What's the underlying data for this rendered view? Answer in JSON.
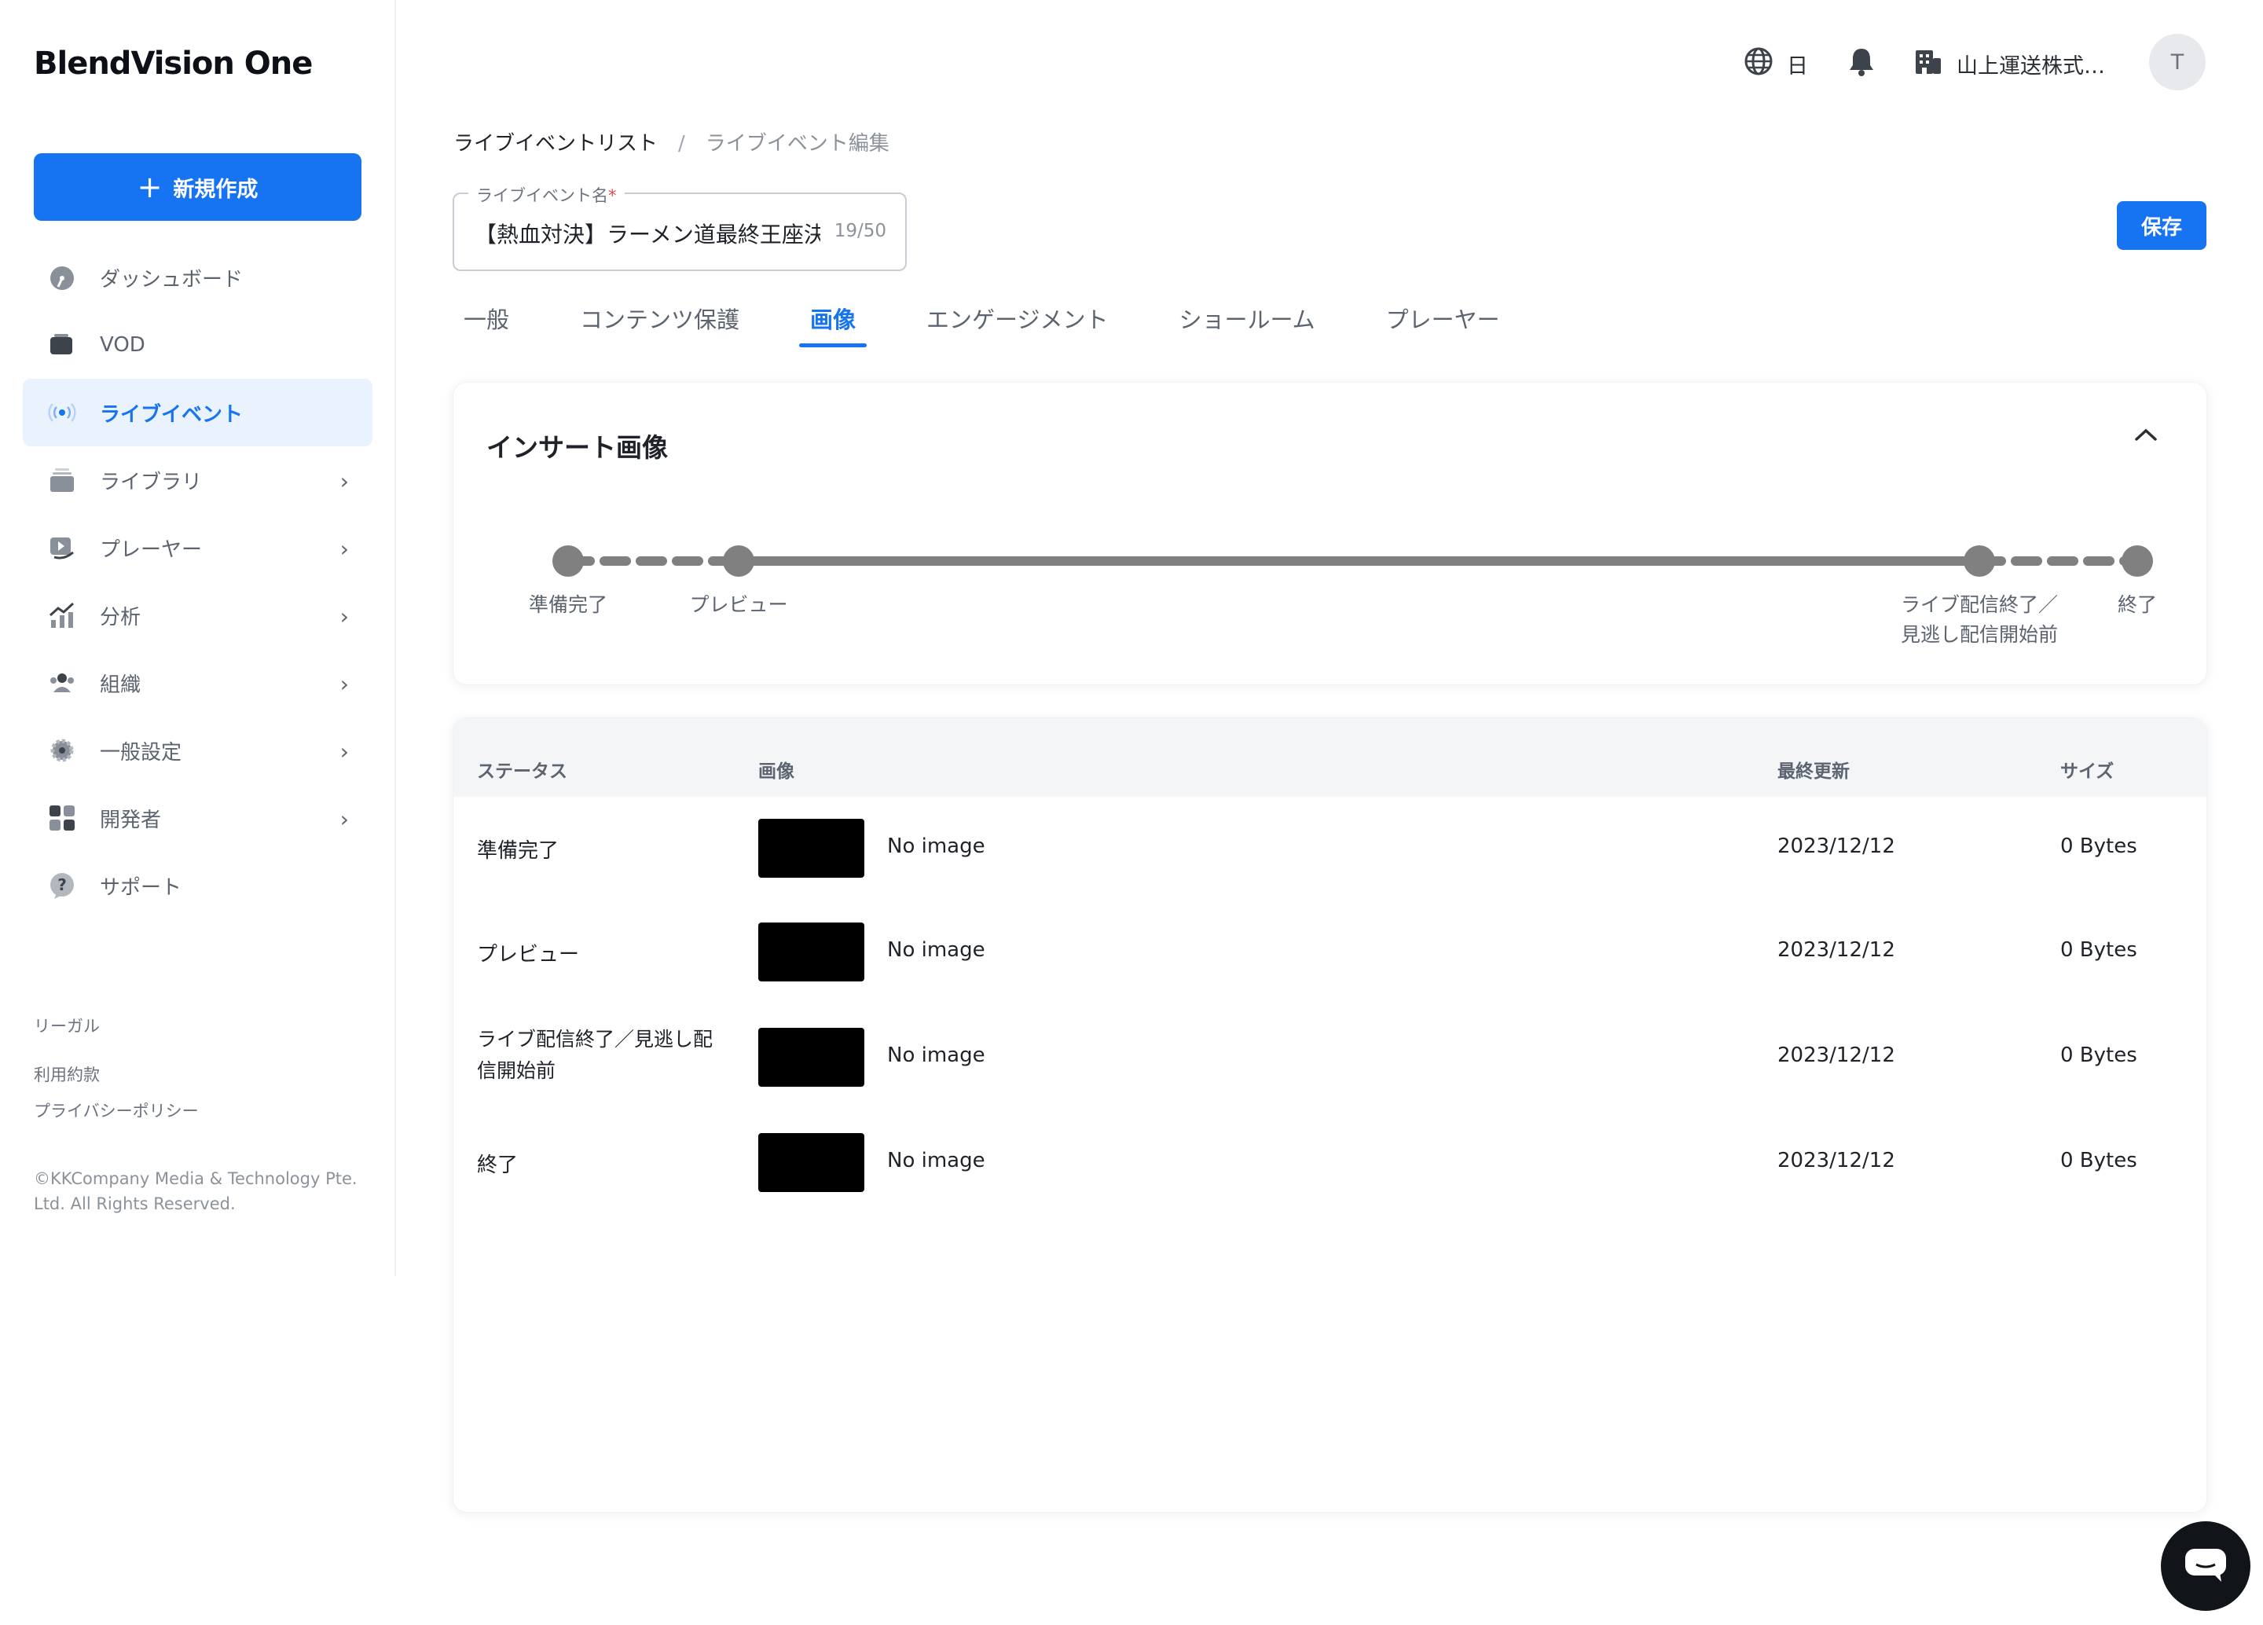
{
  "app": {
    "logo": "BlendVision One"
  },
  "sidebar": {
    "new_button": "新規作成",
    "items": [
      {
        "label": "ダッシュボード",
        "icon": "dashboard-icon"
      },
      {
        "label": "VOD",
        "icon": "vod-icon"
      },
      {
        "label": "ライブイベント",
        "icon": "live-broadcast-icon",
        "active": true
      },
      {
        "label": "ライブラリ",
        "icon": "library-icon"
      },
      {
        "label": "プレーヤー",
        "icon": "player-icon"
      },
      {
        "label": "分析",
        "icon": "analytics-icon"
      },
      {
        "label": "組織",
        "icon": "organization-icon"
      },
      {
        "label": "一般設定",
        "icon": "settings-gear-icon"
      },
      {
        "label": "開発者",
        "icon": "developer-grid-icon"
      },
      {
        "label": "サポート",
        "icon": "support-help-icon"
      }
    ],
    "legal_title": "リーガル",
    "terms": "利用約款",
    "privacy": "プライバシーポリシー",
    "copyright_line1": "©KKCompany Media & Technology Pte.",
    "copyright_line2": "Ltd. All Rights Reserved."
  },
  "header": {
    "language": "日",
    "organization": "山上運送株式…",
    "avatar_initial": "T"
  },
  "breadcrumb": {
    "parent": "ライブイベントリスト",
    "separator": "/",
    "current": "ライブイベント編集"
  },
  "event_name_field": {
    "label": "ライブイベント名",
    "required_mark": "*",
    "value": "【熱血対決】ラーメン道最終王座決",
    "counter": "19/50"
  },
  "save_button": "保存",
  "tabs": [
    {
      "label": "一般"
    },
    {
      "label": "コンテンツ保護"
    },
    {
      "label": "画像",
      "active": true
    },
    {
      "label": "エンゲージメント"
    },
    {
      "label": "ショールーム"
    },
    {
      "label": "プレーヤー"
    }
  ],
  "insert_images": {
    "title": "インサート画像",
    "steps": {
      "ready": "準備完了",
      "preview": "プレビュー",
      "ended_line1": "ライブ配信終了／",
      "ended_line2": "見逃し配信開始前",
      "end": "終了"
    }
  },
  "table": {
    "headers": {
      "status": "ステータス",
      "image": "画像",
      "updated": "最終更新",
      "size": "サイズ"
    },
    "rows": [
      {
        "status": "準備完了",
        "image_text": "No image",
        "updated": "2023/12/12",
        "size": "0 Bytes"
      },
      {
        "status": "プレビュー",
        "image_text": "No image",
        "updated": "2023/12/12",
        "size": "0 Bytes"
      },
      {
        "status_line1": "ライブ配信終了／見逃し配",
        "status_line2": "信開始前",
        "image_text": "No image",
        "updated": "2023/12/12",
        "size": "0 Bytes"
      },
      {
        "status": "終了",
        "image_text": "No image",
        "updated": "2023/12/12",
        "size": "0 Bytes"
      }
    ]
  },
  "colors": {
    "accent": "#1673f2",
    "timeline": "#808080",
    "active_bg": "#eaf2fe"
  }
}
